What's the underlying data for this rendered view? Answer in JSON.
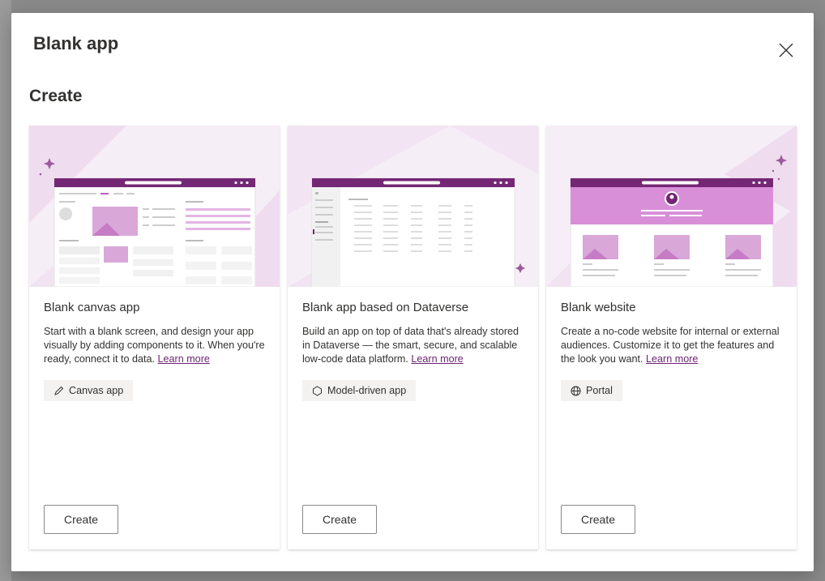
{
  "dialog": {
    "title": "Blank app",
    "section_title": "Create"
  },
  "cards": [
    {
      "title": "Blank canvas app",
      "description": "Start with a blank screen, and design your app visually by adding components to it. When you're ready, connect it to data.",
      "learn_more": "Learn more",
      "tag_icon": "pencil-icon",
      "tag_label": "Canvas app",
      "button_label": "Create"
    },
    {
      "title": "Blank app based on Dataverse",
      "description": "Build an app on top of data that's already stored in Dataverse — the smart, secure, and scalable low-code data platform.",
      "learn_more": "Learn more",
      "tag_icon": "model-driven-icon",
      "tag_label": "Model-driven app",
      "button_label": "Create"
    },
    {
      "title": "Blank website",
      "description": "Create a no-code website for internal or external audiences. Customize it to get the features and the look you want.",
      "learn_more": "Learn more",
      "tag_icon": "globe-icon",
      "tag_label": "Portal",
      "button_label": "Create"
    }
  ],
  "colors": {
    "accent": "#742774",
    "link": "#6b2573",
    "card_image_bg": "#f6eef7",
    "highlight": "#d88fd8"
  }
}
